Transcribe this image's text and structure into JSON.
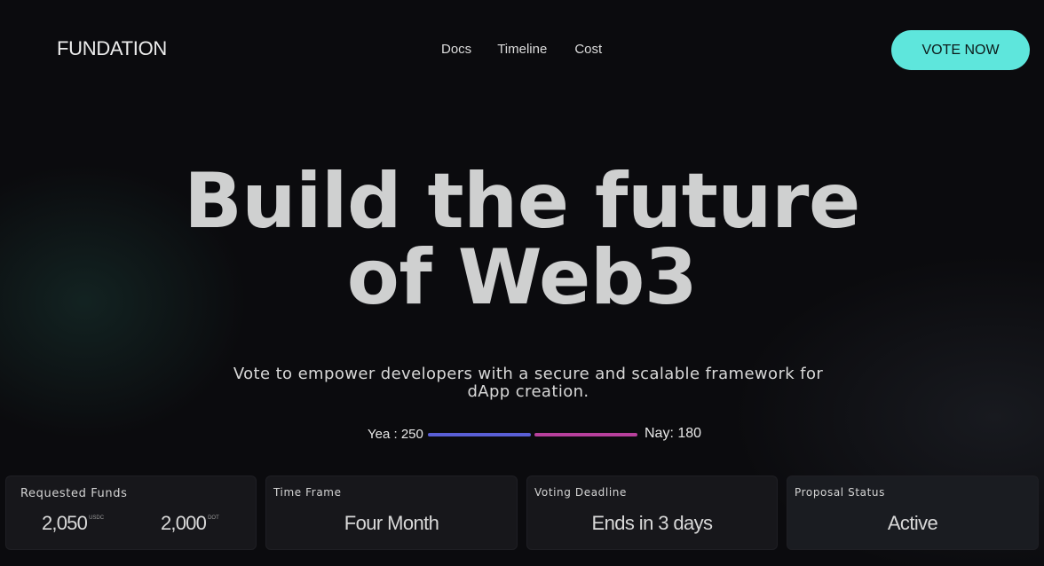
{
  "header": {
    "logo": "FUNDATION",
    "nav": [
      "Docs",
      "Timeline",
      "Cost"
    ],
    "cta": "VOTE NOW"
  },
  "hero": {
    "title_line1": "Build the future",
    "title_line2": "of Web3",
    "subtitle": "Vote to empower developers with a secure and scalable framework for dApp creation."
  },
  "vote": {
    "yea_label": "Yea : 250",
    "nay_label": "Nay: 180",
    "yea_color": "#5a5fd6",
    "nay_color": "#b8409c"
  },
  "cards": {
    "requested_funds": {
      "label": "Requested Funds",
      "amount1": "2,050",
      "unit1": "USDC",
      "amount2": "2,000",
      "unit2": "DOT"
    },
    "time_frame": {
      "label": "Time Frame",
      "value": "Four Month"
    },
    "voting_deadline": {
      "label": "Voting Deadline",
      "value": "Ends in 3 days"
    },
    "proposal_status": {
      "label": "Proposal Status",
      "value": "Active"
    }
  },
  "colors": {
    "accent": "#5ee6dc",
    "background": "#0b0b0e",
    "card": "#17171b"
  }
}
